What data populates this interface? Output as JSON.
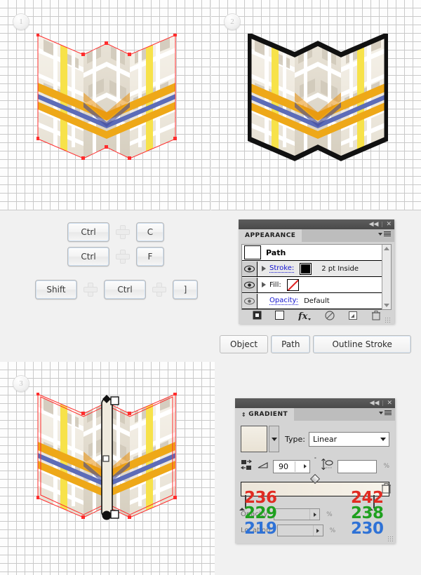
{
  "steps": [
    {
      "number": "1"
    },
    {
      "number": "2"
    },
    {
      "number": "3"
    }
  ],
  "shortcuts": [
    {
      "keys": [
        "Ctrl",
        "C"
      ]
    },
    {
      "keys": [
        "Ctrl",
        "F"
      ]
    },
    {
      "keys": [
        "Shift",
        "Ctrl",
        "]"
      ]
    }
  ],
  "menu_path": {
    "items": [
      "Object",
      "Path",
      "Outline Stroke"
    ]
  },
  "appearance_panel": {
    "tab_label": "APPEARANCE",
    "target_label": "Path",
    "rows": [
      {
        "label": "Stroke:",
        "value": "2 pt  Inside",
        "swatch": "black",
        "link": true
      },
      {
        "label": "Fill:",
        "value": "",
        "swatch": "none",
        "link": false
      },
      {
        "label": "Opacity:",
        "value": "Default",
        "swatch": "",
        "link": true
      }
    ],
    "footer_icons": [
      "add-new-stroke-icon",
      "add-new-fill-icon",
      "add-new-effect-icon",
      "clear-appearance-icon",
      "duplicate-item-icon",
      "delete-item-icon"
    ],
    "window_controls": [
      "collapse-icon",
      "close-icon"
    ]
  },
  "gradient_panel": {
    "tab_label": "GRADIENT",
    "type_label": "Type:",
    "type_value": "Linear",
    "angle_value": "90",
    "degree_symbol": "°",
    "aspect_value": "",
    "percent_symbol": "%",
    "opacity_label": "Opacity:",
    "opacity_value": "",
    "location_label": "Location:",
    "location_value": "",
    "window_controls": [
      "collapse-icon",
      "close-icon"
    ]
  },
  "gradient_stops": {
    "left": {
      "r": "236",
      "g": "229",
      "b": "219"
    },
    "right": {
      "r": "242",
      "g": "238",
      "b": "230"
    }
  },
  "colors": {
    "map_paper_light": "#f3efe7",
    "map_paper_mid": "#e3ddd0",
    "map_paper_dark": "#cfc7b8",
    "road_yellow": "#f7e24a",
    "road_orange": "#eea818",
    "road_orange_dark": "#e8900d",
    "road_blue": "#5c6cb8",
    "road_blue_dark": "#41499b",
    "selection_red": "#ff2d2d",
    "stroke_black": "#111111",
    "grid_line": "#c9c9c9",
    "panel_bg": "#d4d4d4"
  }
}
